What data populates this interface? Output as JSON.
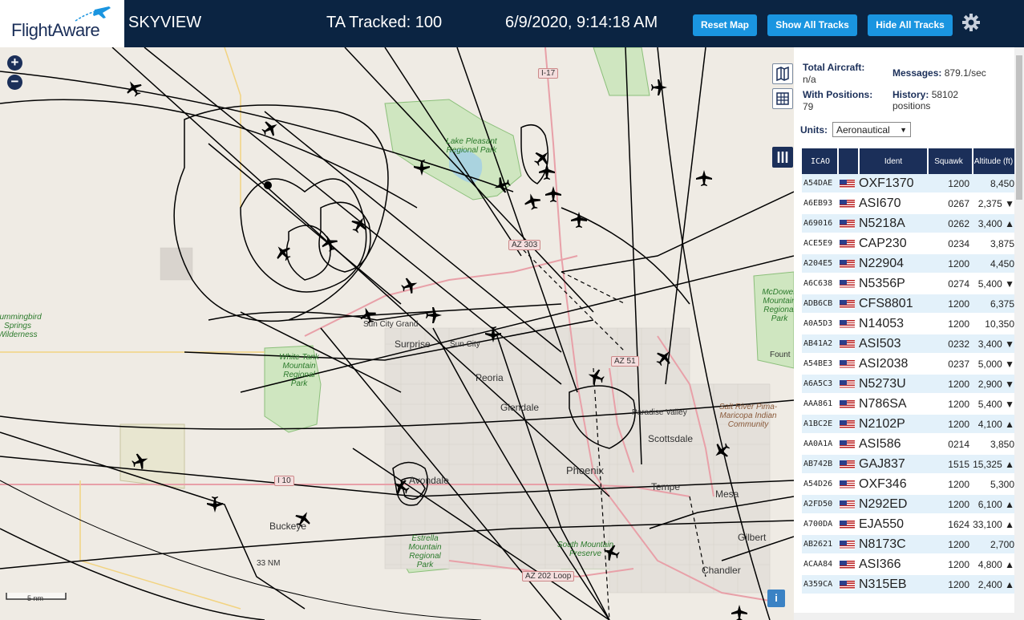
{
  "header": {
    "logo_text": "FlightAware",
    "app_title": "SKYVIEW",
    "tracked": "TA Tracked: 100",
    "datetime": "6/9/2020, 9:14:18 AM",
    "buttons": {
      "reset": "Reset Map",
      "show_all": "Show All Tracks",
      "hide_all": "Hide All Tracks"
    },
    "accent_color": "#1a95e0",
    "bar_color": "#0b2442"
  },
  "map": {
    "zoom_in": "+",
    "zoom_out": "−",
    "scale_label": "5 nm",
    "range_label": "33 NM",
    "info_label": "i",
    "road_labels": [
      "I-17",
      "AZ 303",
      "AZ 51",
      "I 10",
      "AZ 202 Loop"
    ],
    "city_labels": [
      "Surprise",
      "Sun City",
      "Peoria",
      "Glendale",
      "Phoenix",
      "Scottsdale",
      "Tempe",
      "Mesa",
      "Gilbert",
      "Chandler",
      "Buckeye",
      "Avondale",
      "Paradise Valley",
      "Fount",
      "Sun City Grand"
    ],
    "park_labels": [
      "Lake Pleasant Regional Park",
      "White Tank Mountain Regional Park",
      "Estrella Mountain Regional Park",
      "South Mountain Preserve",
      "McDowell Mountain Regional Park",
      "Hummingbird Springs Wilderness",
      "Salt River Pima-Maricopa Indian Community"
    ]
  },
  "panel": {
    "total_aircraft_label": "Total Aircraft:",
    "total_aircraft_value": "n/a",
    "with_positions_label": "With Positions:",
    "with_positions_value": "79",
    "messages_label": "Messages:",
    "messages_value": "879.1/sec",
    "history_label": "History:",
    "history_value": "58102 positions",
    "units_label": "Units:",
    "units_value": "Aeronautical"
  },
  "table": {
    "headers": [
      "ICAO",
      "",
      "Ident",
      "Squawk",
      "Altitude (ft)"
    ],
    "rows": [
      {
        "icao": "A54DAE",
        "ident": "OXF1370",
        "squawk": "1200",
        "alt": "8,450"
      },
      {
        "icao": "A6EB93",
        "ident": "ASI670",
        "squawk": "0267",
        "alt": "2,375 ▼"
      },
      {
        "icao": "A69016",
        "ident": "N5218A",
        "squawk": "0262",
        "alt": "3,400 ▲"
      },
      {
        "icao": "ACE5E9",
        "ident": "CAP230",
        "squawk": "0234",
        "alt": "3,875"
      },
      {
        "icao": "A204E5",
        "ident": "N22904",
        "squawk": "1200",
        "alt": "4,450"
      },
      {
        "icao": "A6C638",
        "ident": "N5356P",
        "squawk": "0274",
        "alt": "5,400 ▼"
      },
      {
        "icao": "ADB6CB",
        "ident": "CFS8801",
        "squawk": "1200",
        "alt": "6,375"
      },
      {
        "icao": "A0A5D3",
        "ident": "N14053",
        "squawk": "1200",
        "alt": "10,350"
      },
      {
        "icao": "AB41A2",
        "ident": "ASI503",
        "squawk": "0232",
        "alt": "3,400 ▼"
      },
      {
        "icao": "A54BE3",
        "ident": "ASI2038",
        "squawk": "0237",
        "alt": "5,000 ▼"
      },
      {
        "icao": "A6A5C3",
        "ident": "N5273U",
        "squawk": "1200",
        "alt": "2,900 ▼"
      },
      {
        "icao": "AAA861",
        "ident": "N786SA",
        "squawk": "1200",
        "alt": "5,400 ▼"
      },
      {
        "icao": "A1BC2E",
        "ident": "N2102P",
        "squawk": "1200",
        "alt": "4,100 ▲"
      },
      {
        "icao": "AA0A1A",
        "ident": "ASI586",
        "squawk": "0214",
        "alt": "3,850"
      },
      {
        "icao": "AB742B",
        "ident": "GAJ837",
        "squawk": "1515",
        "alt": "15,325 ▲"
      },
      {
        "icao": "A54D26",
        "ident": "OXF346",
        "squawk": "1200",
        "alt": "5,300"
      },
      {
        "icao": "A2FD50",
        "ident": "N292ED",
        "squawk": "1200",
        "alt": "6,100 ▲"
      },
      {
        "icao": "A700DA",
        "ident": "EJA550",
        "squawk": "1624",
        "alt": "33,100 ▲"
      },
      {
        "icao": "AB2621",
        "ident": "N8173C",
        "squawk": "1200",
        "alt": "2,700"
      },
      {
        "icao": "ACAA84",
        "ident": "ASI366",
        "squawk": "1200",
        "alt": "4,800 ▲"
      },
      {
        "icao": "A359CA",
        "ident": "N315EB",
        "squawk": "1200",
        "alt": "2,400 ▲"
      }
    ]
  }
}
